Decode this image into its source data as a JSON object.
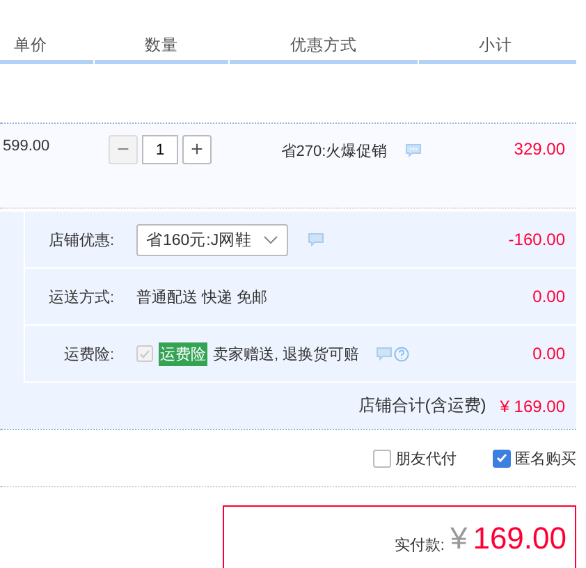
{
  "columns": [
    {
      "label": "单价"
    },
    {
      "label": "数量"
    },
    {
      "label": "优惠方式"
    },
    {
      "label": "小计"
    }
  ],
  "item": {
    "unit_price": "599.00",
    "quantity": {
      "minus": "−",
      "minus_disabled": true,
      "value": "1",
      "plus": "+"
    },
    "promotion": "省270:火爆促销",
    "subtotal": "329.00"
  },
  "shop_rows": [
    {
      "kind": "select",
      "label": "店铺优惠:",
      "value": "省160元:J网鞋",
      "amount": "-160.00"
    },
    {
      "kind": "text",
      "label": "运送方式:",
      "value": "普通配送 快递 免邮",
      "amount": "0.00"
    },
    {
      "kind": "insurance",
      "label": "运费险:",
      "checked": true,
      "disabled": true,
      "badge": "运费险",
      "value": "卖家赠送, 退换货可赔",
      "amount": "0.00"
    }
  ],
  "shop_total": {
    "label": "店铺合计(含运费)",
    "amount": "¥ 169.00"
  },
  "options": [
    {
      "label": "朋友代付",
      "checked": false
    },
    {
      "label": "匿名购买",
      "checked": true
    }
  ],
  "payment": {
    "label": "实付款:",
    "currency": "¥",
    "amount": "169.00"
  }
}
